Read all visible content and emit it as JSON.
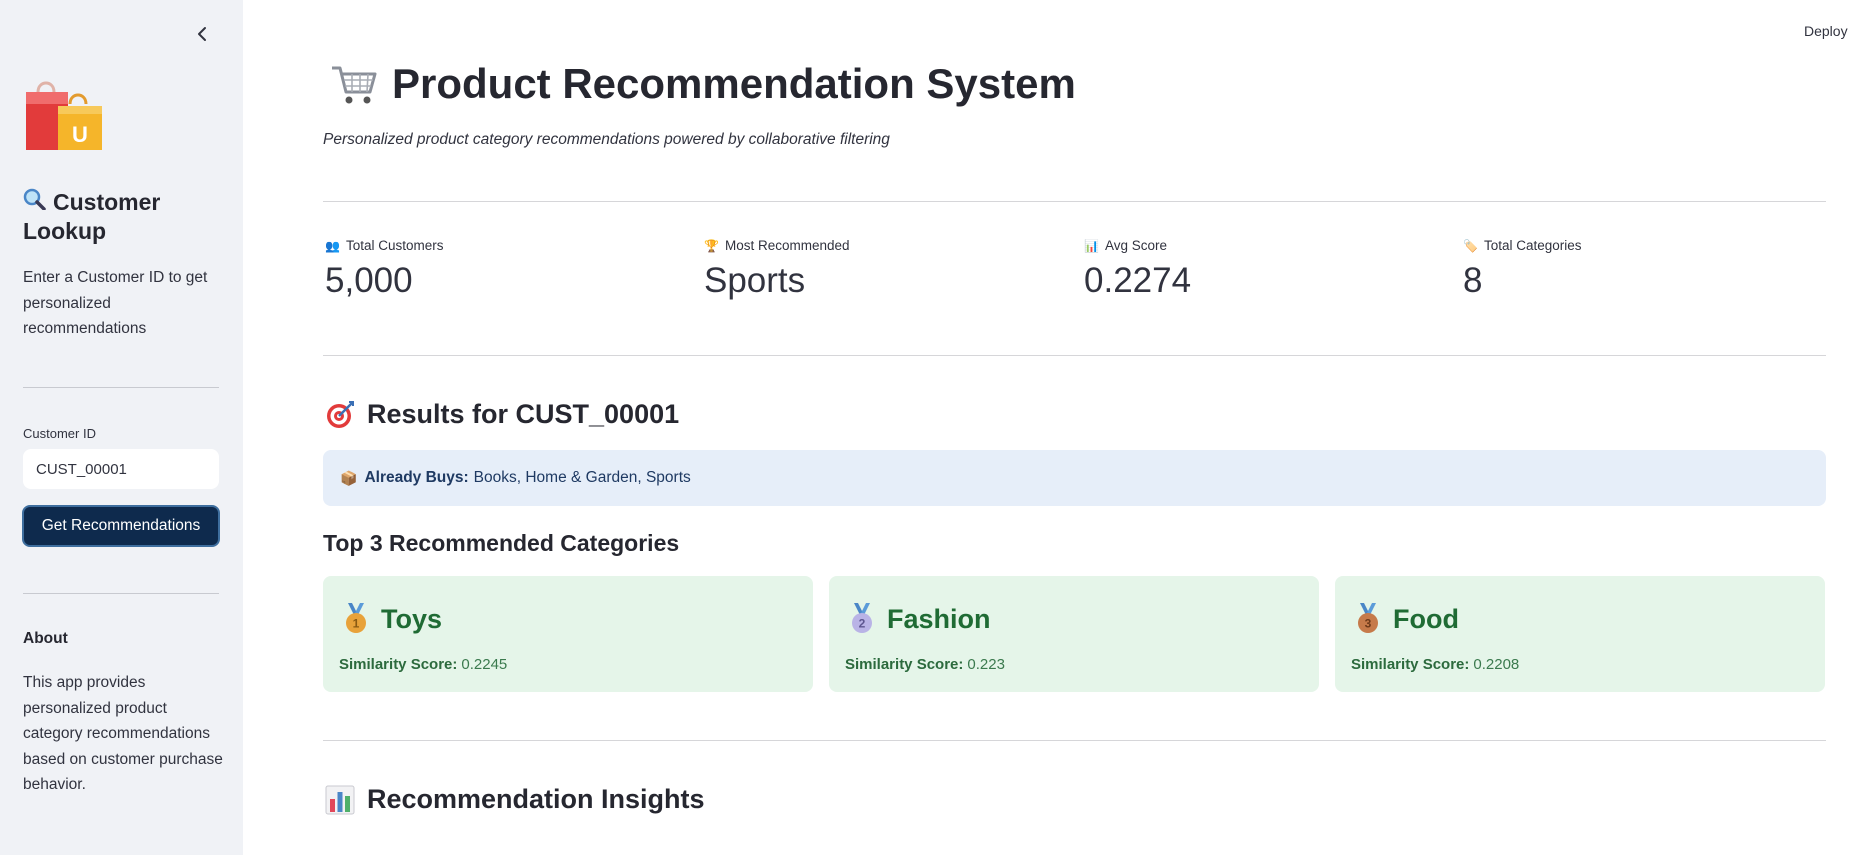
{
  "sidebar": {
    "title": "Customer Lookup",
    "description": "Enter a Customer ID to get personalized recommendations",
    "customer_id_label": "Customer ID",
    "customer_id_value": "CUST_00001",
    "button_label": "Get Recommendations",
    "about_heading": "About",
    "about_text": "This app provides personalized product category recommendations based on customer purchase behavior.",
    "logo_letter": "U"
  },
  "header": {
    "deploy_label": "Deploy"
  },
  "main": {
    "title": "Product Recommendation System",
    "subtitle": "Personalized product category recommendations powered by collaborative filtering",
    "metrics": [
      {
        "icon": "people-icon",
        "glyph": "👥",
        "label": "Total Customers",
        "value": "5,000"
      },
      {
        "icon": "trophy-icon",
        "glyph": "🏆",
        "label": "Most Recommended",
        "value": "Sports"
      },
      {
        "icon": "bar-chart-icon",
        "glyph": "📊",
        "label": "Avg Score",
        "value": "0.2274"
      },
      {
        "icon": "tag-icon",
        "glyph": "🏷️",
        "label": "Total Categories",
        "value": "8"
      }
    ],
    "results_heading": "Results for CUST_00001",
    "already_buys_label": "Already Buys:",
    "already_buys_value": "Books, Home & Garden, Sports",
    "top_heading": "Top 3 Recommended Categories",
    "cards": [
      {
        "rank": "1",
        "name": "Toys",
        "score_label": "Similarity Score:",
        "score": "0.2245",
        "medal_color": "#e8a23a"
      },
      {
        "rank": "2",
        "name": "Fashion",
        "score_label": "Similarity Score:",
        "score": "0.223",
        "medal_color": "#b9b3e6"
      },
      {
        "rank": "3",
        "name": "Food",
        "score_label": "Similarity Score:",
        "score": "0.2208",
        "medal_color": "#c67a4a"
      }
    ],
    "insights_heading": "Recommendation Insights"
  },
  "colors": {
    "sidebar_bg": "#f0f2f6",
    "button_bg": "#0e2a4d",
    "info_bg": "#e6eef9",
    "card_bg": "#e5f5e9",
    "card_text": "#1f6b34"
  }
}
